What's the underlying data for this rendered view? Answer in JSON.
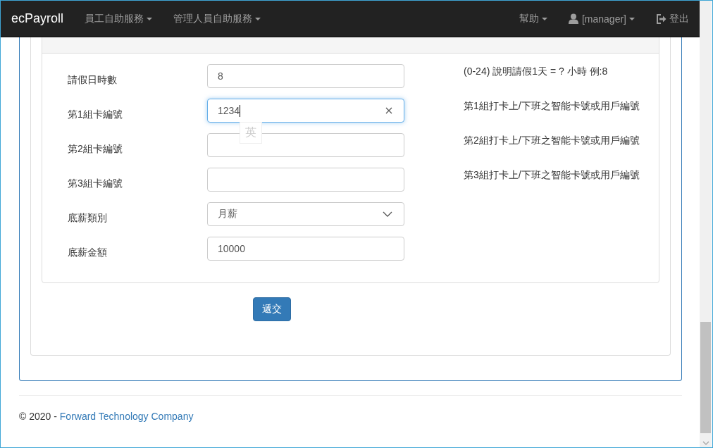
{
  "navbar": {
    "brand": "ecPayroll",
    "menus": [
      {
        "label": "員工自助服務",
        "dropdown": true
      },
      {
        "label": "管理人員自助服務",
        "dropdown": true
      }
    ],
    "right": [
      {
        "kind": "dropdown",
        "label": "幫助"
      },
      {
        "kind": "user",
        "label": "[manager]"
      },
      {
        "kind": "logout",
        "label": "登出"
      }
    ]
  },
  "panel": {
    "fields": [
      {
        "label": "請假日時數",
        "kind": "text",
        "value": "8",
        "focused": false,
        "help": "(0-24) 說明請假1天 = ? 小時 例:8"
      },
      {
        "label": "第1組卡編號",
        "kind": "text",
        "value": "1234",
        "focused": true,
        "help": "第1組打卡上/下班之智能卡號或用戶編號"
      },
      {
        "label": "第2組卡編號",
        "kind": "text",
        "focused": false,
        "help": "第2組打卡上/下班之智能卡號或用戶編號"
      },
      {
        "label": "第3組卡編號",
        "kind": "text",
        "focused": false,
        "help": "第3組打卡上/下班之智能卡號或用戶編號"
      },
      {
        "label": "底薪類別",
        "kind": "select",
        "value": "月薪",
        "focused": false
      },
      {
        "label": "底薪金額",
        "kind": "text",
        "value": "10000",
        "focused": false
      }
    ]
  },
  "ime_indicator": "英",
  "submit": "遞交",
  "footer": {
    "copyright": "© 2020 - ",
    "link": "Forward Technology Company"
  }
}
